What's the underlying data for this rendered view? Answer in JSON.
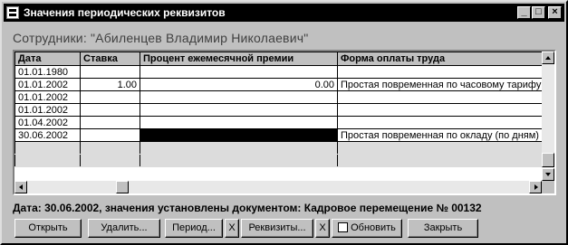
{
  "window": {
    "title": "Значения периодических реквизитов",
    "caption": "Сотрудники: \"Абиленцев Владимир Николаевич\"",
    "min_glyph": "_",
    "max_glyph": "□",
    "close_glyph": "×"
  },
  "grid": {
    "columns": [
      "Дата",
      "Ставка",
      "Процент ежемесячной премии",
      "Форма оплаты труда"
    ],
    "rows": [
      {
        "date": "01.01.1980",
        "rate": "",
        "bonus": "",
        "pay_form": ""
      },
      {
        "date": "01.01.2002",
        "rate": "1.00",
        "bonus": "0.00",
        "pay_form": "Простая повременная по часовому тарифу"
      },
      {
        "date": "01.01.2002",
        "rate": "",
        "bonus": "",
        "pay_form": ""
      },
      {
        "date": "01.01.2002",
        "rate": "",
        "bonus": "",
        "pay_form": ""
      },
      {
        "date": "01.04.2002",
        "rate": "",
        "bonus": "",
        "pay_form": ""
      },
      {
        "date": "30.06.2002",
        "rate": "",
        "bonus": "",
        "pay_form": "Простая повременная по окладу (по дням)"
      }
    ]
  },
  "status": "Дата: 30.06.2002, значения установлены документом: Кадровое перемещение № 00132",
  "buttons": {
    "open": "Открыть",
    "delete": "Удалить...",
    "period": "Период...",
    "x1": "X",
    "requisites": "Реквизиты...",
    "x2": "X",
    "refresh": "Обновить",
    "close": "Закрыть"
  }
}
